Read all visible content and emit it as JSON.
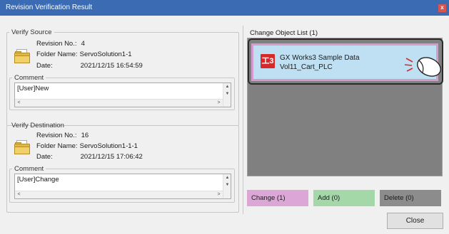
{
  "window": {
    "title": "Revision Verification Result",
    "close_glyph": "x"
  },
  "source": {
    "legend": "Verify Source",
    "revision_label": "Revision No.:",
    "revision_value": "4",
    "folder_label": "Folder Name:",
    "folder_value": "ServoSolution1-1",
    "date_label": "Date:",
    "date_value": "2021/12/15 16:54:59",
    "comment_legend": "Comment",
    "comment_value": "[User]New"
  },
  "destination": {
    "legend": "Verify Destination",
    "revision_label": "Revision No.:",
    "revision_value": "16",
    "folder_label": "Folder Name:",
    "folder_value": "ServoSolution1-1-1",
    "date_label": "Date:",
    "date_value": "2021/12/15 17:06:42",
    "comment_legend": "Comment",
    "comment_value": "[User]Change"
  },
  "change_list": {
    "legend": "Change Object List (1)",
    "item_line1": "GX Works3 Sample Data",
    "item_line2": "Vol11_Cart_PLC",
    "item_icon": "gx-works3-icon",
    "item_icon_glyph": "工3"
  },
  "legend_boxes": [
    {
      "label": "Change (1)",
      "color": "#dca7d6"
    },
    {
      "label": "Add (0)",
      "color": "#a4d8a8"
    },
    {
      "label": "Delete (0)",
      "color": "#8c8c8c"
    }
  ],
  "scroll_glyphs": {
    "up": "▲",
    "down": "▼",
    "left": "<",
    "right": ">"
  },
  "buttons": {
    "close": "Close"
  }
}
